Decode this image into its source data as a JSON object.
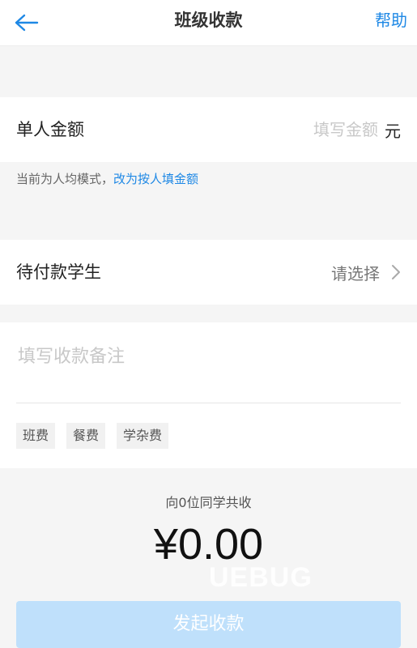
{
  "header": {
    "title": "班级收款",
    "help_label": "帮助"
  },
  "amount": {
    "label": "单人金额",
    "placeholder": "填写金额",
    "value": "",
    "unit": "元"
  },
  "mode": {
    "text": "当前为人均模式，",
    "switch_link": "改为按人填金额"
  },
  "students": {
    "label": "待付款学生",
    "select_text": "请选择"
  },
  "note": {
    "placeholder": "填写收款备注",
    "value": "",
    "tags": [
      "班费",
      "餐费",
      "学杂费"
    ]
  },
  "summary": {
    "text": "向0位同学共收",
    "total": "¥0.00"
  },
  "watermark": "UEBUG",
  "submit_label": "发起收款",
  "colors": {
    "accent": "#1e88e5",
    "button_disabled": "#bfe0fb",
    "background": "#f5f5f5"
  }
}
